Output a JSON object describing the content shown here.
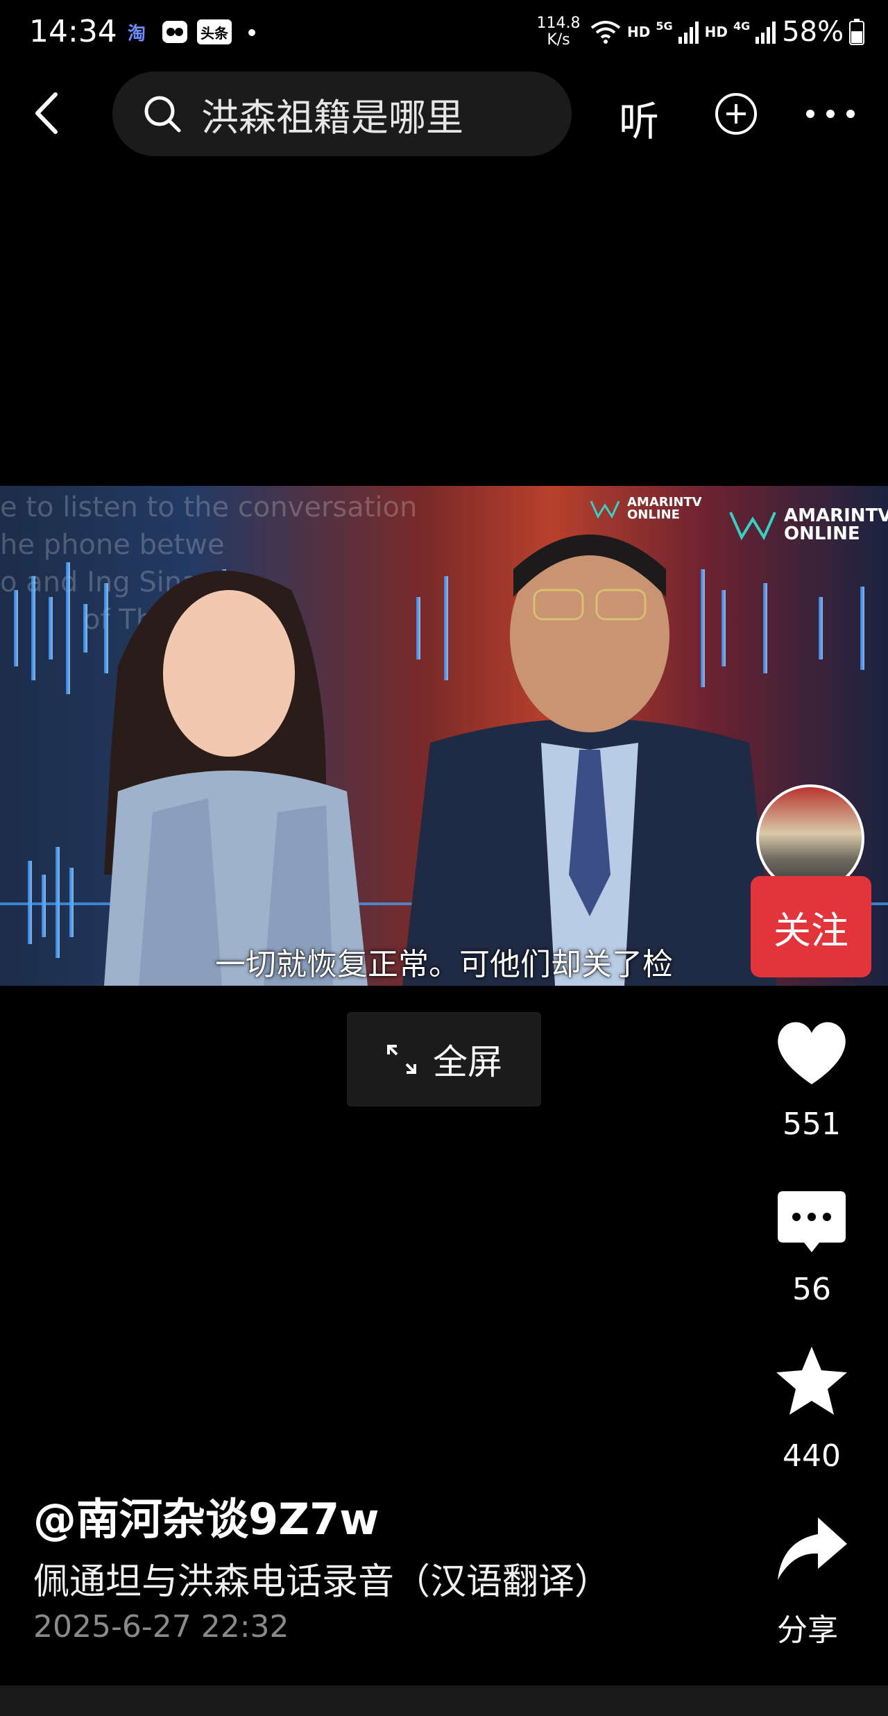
{
  "status_bar": {
    "time": "14:34",
    "app_icons": [
      "淘",
      "头条"
    ],
    "net_speed_value": "114.8",
    "net_speed_unit": "K/s",
    "hd1": "HD",
    "net1": "5G",
    "hd2": "HD",
    "net2": "4G",
    "battery": "58%"
  },
  "top_bar": {
    "search_text": "洪森祖籍是哪里",
    "listen_label": "听"
  },
  "video": {
    "watermark_small": [
      "AMARINTV",
      "ONLINE"
    ],
    "watermark_large": [
      "AMARINTV",
      "ONLINE"
    ],
    "background_text": [
      "e to listen to the conversation",
      "he phone betwe",
      "o and Ing Sina",
      "of Thailan"
    ],
    "subtitle": "一切就恢复正常。可他们却关了检"
  },
  "fullscreen_label": "全屏",
  "actions": {
    "follow_label": "关注",
    "like_count": "551",
    "comment_count": "56",
    "favorite_count": "440",
    "share_label": "分享"
  },
  "post": {
    "author": "@南河杂谈9Z7w",
    "title": "佩通坦与洪森电话录音（汉语翻译）",
    "time": "2025-6-27 22:32"
  }
}
